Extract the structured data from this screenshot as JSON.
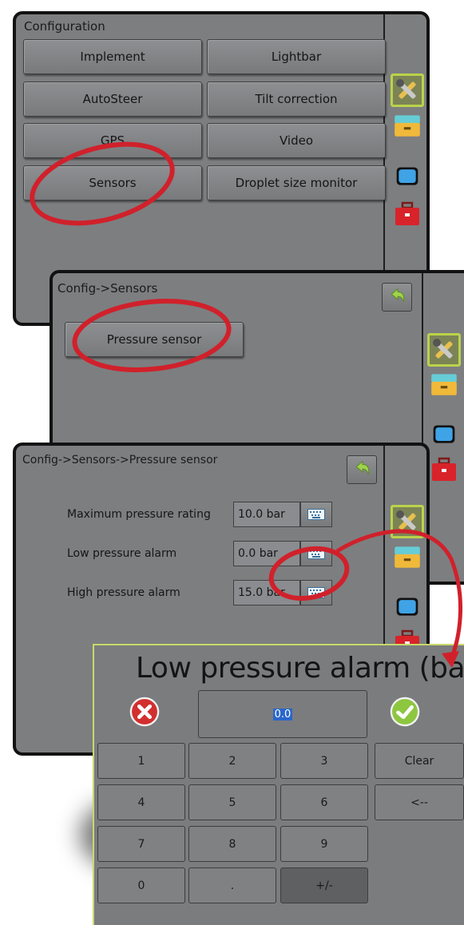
{
  "screen1": {
    "title": "Configuration",
    "buttons": [
      "Implement",
      "Lightbar",
      "AutoSteer",
      "Tilt correction",
      "GPS",
      "Video",
      "Sensors",
      "Droplet size monitor"
    ]
  },
  "screen2": {
    "title": "Config->Sensors",
    "button": "Pressure sensor"
  },
  "screen3": {
    "title": "Config->Sensors->Pressure sensor",
    "rows": [
      {
        "label": "Maximum pressure rating",
        "value": "10.0 bar"
      },
      {
        "label": "Low pressure alarm",
        "value": "0.0 bar"
      },
      {
        "label": "High pressure alarm",
        "value": "15.0 bar"
      }
    ]
  },
  "keypad": {
    "title": "Low pressure alarm (bar)",
    "value": "0.0",
    "keys": [
      "1",
      "2",
      "3",
      "Clear",
      "4",
      "5",
      "6",
      "<--",
      "7",
      "8",
      "9",
      "0",
      ".",
      "+/-"
    ]
  },
  "icons": {
    "tools": "tools-icon",
    "implement": "implement-icon",
    "display": "display-icon",
    "toolbox": "toolbox-icon",
    "back": "back-arrow-icon",
    "keyboard": "keyboard-icon",
    "cancel": "cancel-icon",
    "accept": "accept-icon"
  },
  "colors": {
    "screen_bg": "#7d7e80",
    "selected_border": "#b9d34a",
    "annotation_red": "#d0212b",
    "accept_green": "#8dc63f",
    "cancel_red": "#d32f2f"
  }
}
